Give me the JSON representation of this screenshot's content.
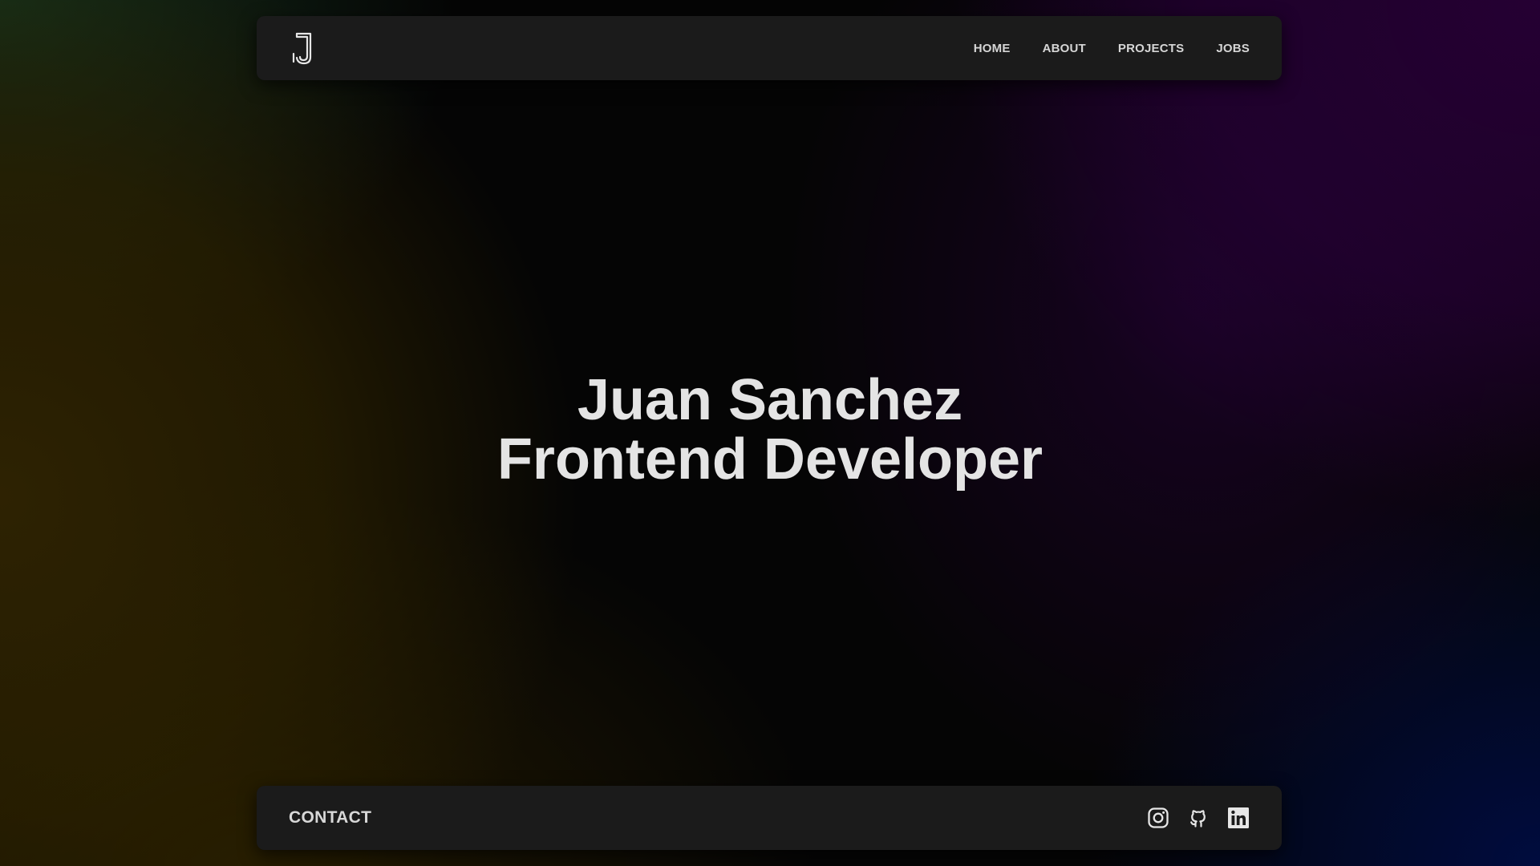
{
  "header": {
    "logo_icon": "j-monogram-logo-icon",
    "nav": [
      {
        "label": "HOME"
      },
      {
        "label": "ABOUT"
      },
      {
        "label": "PROJECTS"
      },
      {
        "label": "JOBS"
      }
    ]
  },
  "hero": {
    "name": "Juan Sanchez",
    "role": "Frontend Developer"
  },
  "footer": {
    "contact_label": "CONTACT",
    "social_icons": [
      "instagram-icon",
      "github-icon",
      "linkedin-icon"
    ]
  },
  "colors": {
    "panel": "#1b1b1b",
    "text": "#e4e4e4",
    "nav_text": "#d6d6d6"
  }
}
